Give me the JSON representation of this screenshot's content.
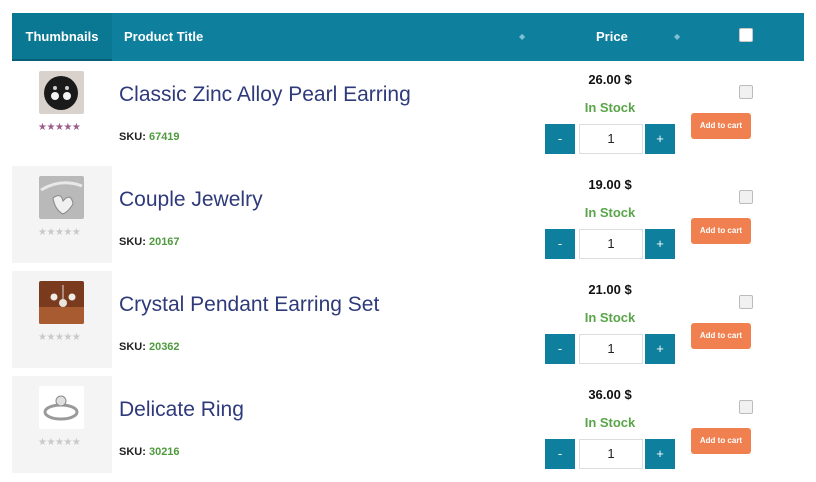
{
  "header": {
    "thumbnails": "Thumbnails",
    "product_title": "Product Title",
    "price": "Price",
    "sort_icon": "◆"
  },
  "colors": {
    "header_bg": "#0e7f9c",
    "cart_button": "#f08050",
    "in_stock": "#5aa54a",
    "title": "#2f3a7a"
  },
  "products": [
    {
      "title": "Classic Zinc Alloy Pearl Earring",
      "sku_label": "SKU:",
      "sku": "67419",
      "price": "26.00 $",
      "stock": "In Stock",
      "qty": "1",
      "minus": "-",
      "plus": "+",
      "cart": "Add to cart",
      "rating": 5,
      "thumbnail": "pearl-earring-image"
    },
    {
      "title": "Couple Jewelry",
      "sku_label": "SKU:",
      "sku": "20167",
      "price": "19.00 $",
      "stock": "In Stock",
      "qty": "1",
      "minus": "-",
      "plus": "+",
      "cart": "Add to cart",
      "rating": 0,
      "thumbnail": "heart-pendant-image"
    },
    {
      "title": "Crystal Pendant Earring Set",
      "sku_label": "SKU:",
      "sku": "20362",
      "price": "21.00 $",
      "stock": "In Stock",
      "qty": "1",
      "minus": "-",
      "plus": "+",
      "cart": "Add to cart",
      "rating": 0,
      "thumbnail": "crystal-earring-set-image"
    },
    {
      "title": "Delicate Ring",
      "sku_label": "SKU:",
      "sku": "30216",
      "price": "36.00 $",
      "stock": "In Stock",
      "qty": "1",
      "minus": "-",
      "plus": "+",
      "cart": "Add to cart",
      "rating": 0,
      "thumbnail": "ring-image"
    }
  ]
}
